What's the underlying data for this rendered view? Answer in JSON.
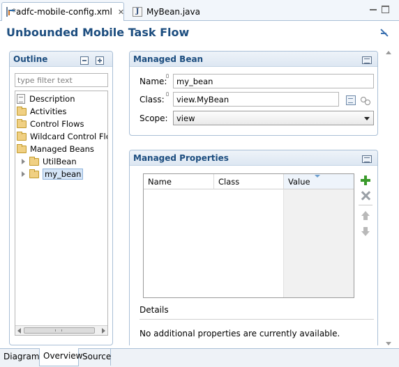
{
  "tabs": [
    {
      "label": "*adfc-mobile-config.xml",
      "icon": "xml-file-icon",
      "active": true
    },
    {
      "label": "MyBean.java",
      "icon": "java-file-icon",
      "active": false
    }
  ],
  "page_title": "Unbounded Mobile Task Flow",
  "outline": {
    "title": "Outline",
    "filter_placeholder": "type filter text",
    "items": [
      {
        "label": "Description",
        "icon": "page-icon"
      },
      {
        "label": "Activities",
        "icon": "folder-icon"
      },
      {
        "label": "Control Flows",
        "icon": "folder-icon"
      },
      {
        "label": "Wildcard Control Flo",
        "icon": "folder-icon"
      },
      {
        "label": "Managed Beans",
        "icon": "folder-icon"
      },
      {
        "label": "UtilBean",
        "icon": "folder-icon"
      },
      {
        "label": "my_bean",
        "icon": "folder-icon",
        "selected": true
      }
    ]
  },
  "bean": {
    "title": "Managed Bean",
    "name_label": "Name:",
    "name_value": "my_bean",
    "class_label": "Class:",
    "class_value": "view.MyBean",
    "scope_label": "Scope:",
    "scope_value": "view"
  },
  "props": {
    "title": "Managed Properties",
    "columns": [
      "Name",
      "Class",
      "Value"
    ],
    "details_label": "Details",
    "details_text": "No additional properties are currently available."
  },
  "bottom_tabs": [
    {
      "label": "Diagram",
      "active": false
    },
    {
      "label": "Overview",
      "active": true
    },
    {
      "label": "Source",
      "active": false
    }
  ],
  "colors": {
    "title": "#1c4d7f",
    "border": "#a9bfd6"
  }
}
